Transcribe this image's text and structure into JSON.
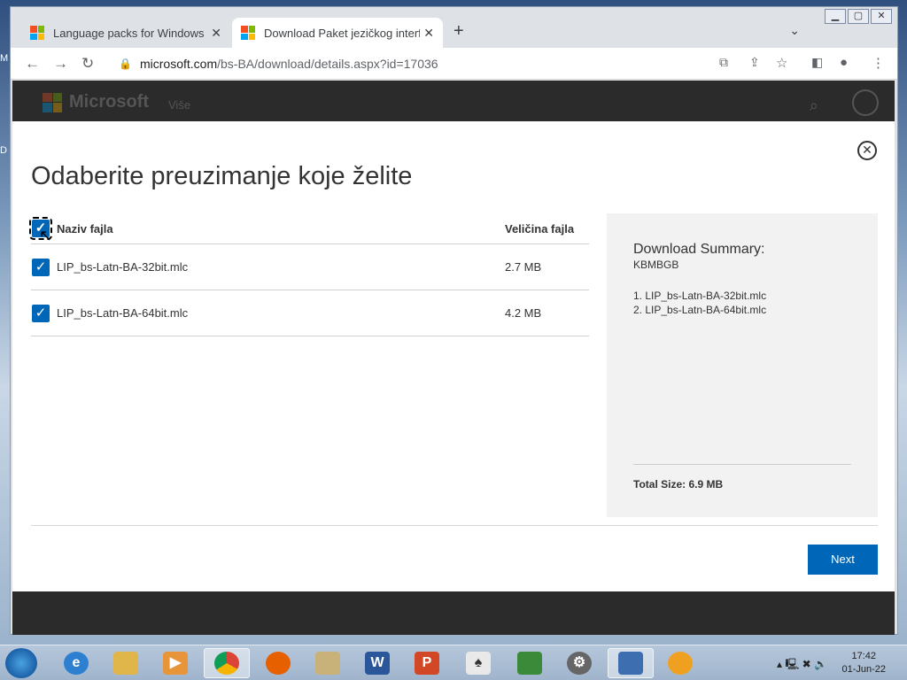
{
  "desktop": {
    "left_labels": [
      "M",
      "D"
    ]
  },
  "browser": {
    "tabs": [
      {
        "title": "Language packs for Windows",
        "active": false
      },
      {
        "title": "Download Paket jezičkog interfejsa",
        "active": true
      }
    ],
    "url_host": "microsoft.com",
    "url_rest": "/bs-BA/download/details.aspx?id=17036"
  },
  "site": {
    "brand": "Microsoft",
    "nav_more": "Više"
  },
  "modal": {
    "title": "Odaberite preuzimanje koje želite",
    "col_name": "Naziv fajla",
    "col_size": "Veličina fajla",
    "files": [
      {
        "name": "LIP_bs-Latn-BA-32bit.mlc",
        "size": "2.7 MB",
        "checked": true
      },
      {
        "name": "LIP_bs-Latn-BA-64bit.mlc",
        "size": "4.2 MB",
        "checked": true
      }
    ],
    "summary_title": "Download Summary:",
    "summary_sub": "KBMBGB",
    "summary_items": [
      "1. LIP_bs-Latn-BA-32bit.mlc",
      "2. LIP_bs-Latn-BA-64bit.mlc"
    ],
    "total_size": "Total Size: 6.9 MB",
    "next_label": "Next"
  },
  "taskbar": {
    "time": "17:42",
    "date": "01-Jun-22"
  }
}
